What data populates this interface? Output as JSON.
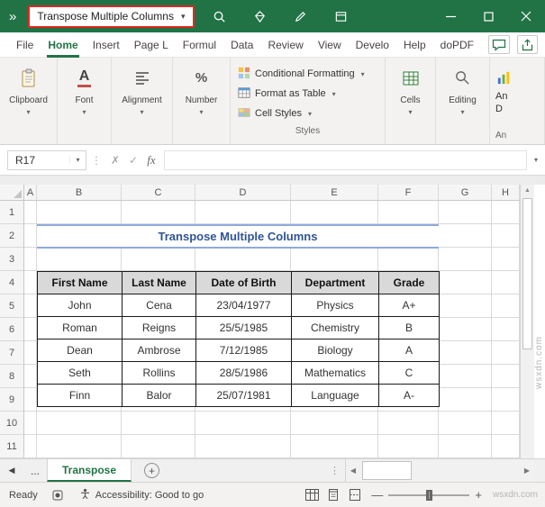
{
  "titlebar": {
    "chevrons": "»",
    "qat_label": "Transpose Multiple Columns"
  },
  "menubar": {
    "items": [
      "File",
      "Home",
      "Insert",
      "Page L",
      "Formul",
      "Data",
      "Review",
      "View",
      "Develo",
      "Help",
      "doPDF"
    ]
  },
  "ribbon": {
    "groups": [
      "Clipboard",
      "Font",
      "Alignment",
      "Number",
      "Cells",
      "Editing"
    ],
    "styles": {
      "label": "Styles",
      "items": [
        "Conditional Formatting",
        "Format as Table",
        "Cell Styles"
      ]
    },
    "analyze": {
      "line1": "An",
      "line2": "D",
      "group_label": "An"
    }
  },
  "formula": {
    "name_box": "R17",
    "fx": "fx",
    "value": ""
  },
  "sheet": {
    "columns": [
      "A",
      "B",
      "C",
      "D",
      "E",
      "F",
      "G",
      "H"
    ],
    "row_numbers": [
      "1",
      "2",
      "3",
      "4",
      "5",
      "6",
      "7",
      "8",
      "9",
      "10",
      "11"
    ],
    "title": "Transpose Multiple Columns",
    "table": {
      "headers": [
        "First Name",
        "Last Name",
        "Date of Birth",
        "Department",
        "Grade"
      ],
      "rows": [
        [
          "John",
          "Cena",
          "23/04/1977",
          "Physics",
          "A+"
        ],
        [
          "Roman",
          "Reigns",
          "25/5/1985",
          "Chemistry",
          "B"
        ],
        [
          "Dean",
          "Ambrose",
          "7/12/1985",
          "Biology",
          "A"
        ],
        [
          "Seth",
          "Rollins",
          "28/5/1986",
          "Mathematics",
          "C"
        ],
        [
          "Finn",
          "Balor",
          "25/07/1981",
          "Language",
          "A-"
        ]
      ]
    }
  },
  "tabs": {
    "ellipsis": "...",
    "active": "Transpose"
  },
  "status": {
    "ready": "Ready",
    "accessibility": "Accessibility: Good to go"
  },
  "watermark": {
    "side": "wsxdn.com",
    "bottom": "wsxdn.com"
  },
  "colors": {
    "excel_green": "#217346",
    "title_blue": "#2F5597",
    "highlight_red": "#E0281E",
    "table_header_bg": "#D9D9D9"
  }
}
